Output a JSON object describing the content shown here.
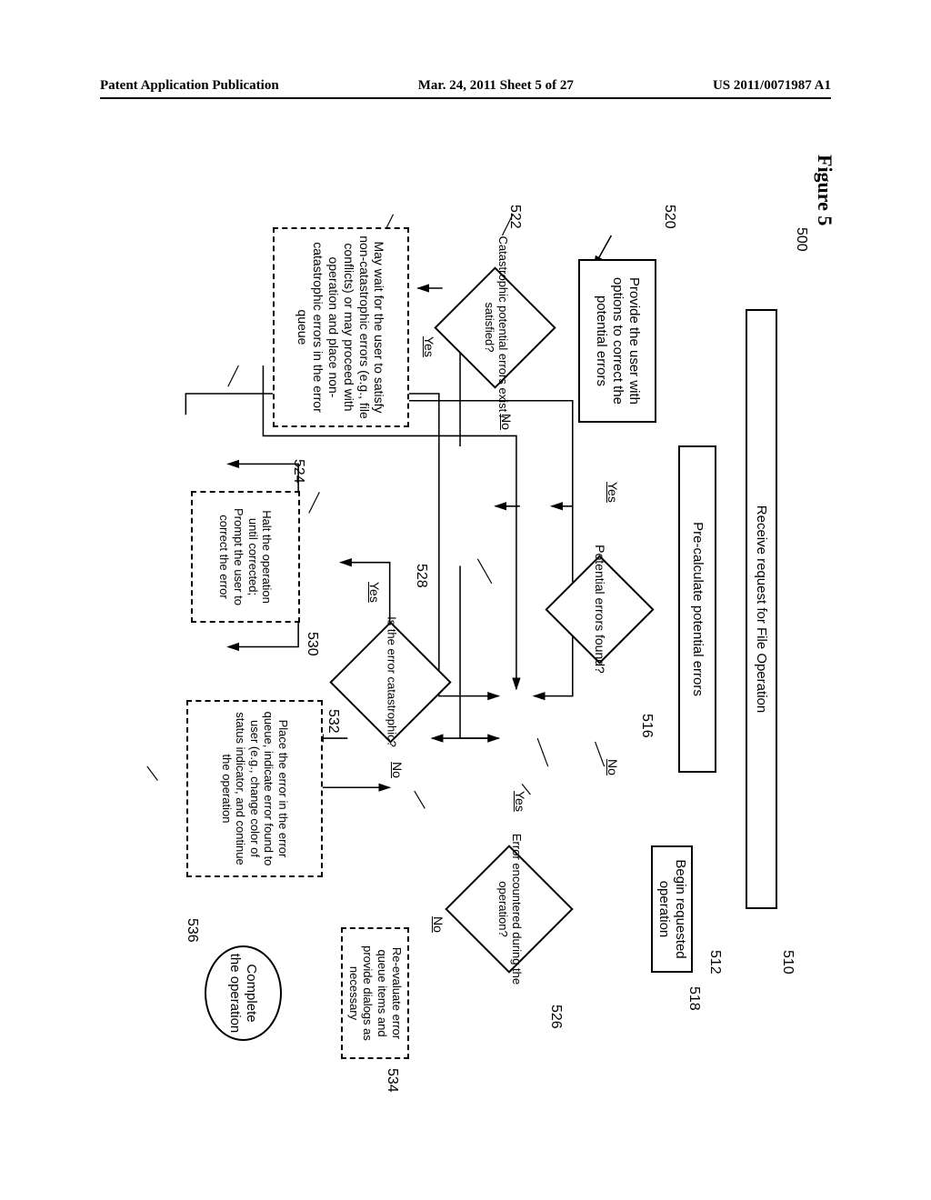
{
  "header": {
    "left": "Patent Application Publication",
    "mid": "Mar. 24, 2011  Sheet 5 of 27",
    "right": "US 2011/0071987 A1"
  },
  "figure_label": "Figure 5",
  "refs": {
    "r500": "500",
    "r510": "510",
    "r512": "512",
    "r516": "516",
    "r518": "518",
    "r520": "520",
    "r522": "522",
    "r524": "524",
    "r526": "526",
    "r528": "528",
    "r530": "530",
    "r532": "532",
    "r534": "534",
    "r536": "536"
  },
  "nodes": {
    "n510": "Receive request for File Operation",
    "n512": "Pre-calculate potential errors",
    "n516": "Potential errors found?",
    "n518": "Begin requested operation",
    "n520": "Provide the user with options to correct the potential errors",
    "n522": "Catastrophic potential errors exist / satisfied?",
    "n524": "May wait for the user to satisfy non-catastrophic errors (e.g., file conflicts) or may proceed with operation and place non-catastrophic errors in the error queue",
    "n526": "Error encountered during the operation?",
    "n528": "Is the error catastrophic?",
    "n530": "Halt the operation until corrected; Prompt the user to correct the error",
    "n532": "Place the error in the error queue, indicate error found to user (e.g., change color of status indicator, and continue the operation",
    "n534": "Re-evaluate error queue items and provide dialogs as necessary",
    "n536": "Complete the operation"
  },
  "edges": {
    "yes": "Yes",
    "no": "No"
  }
}
